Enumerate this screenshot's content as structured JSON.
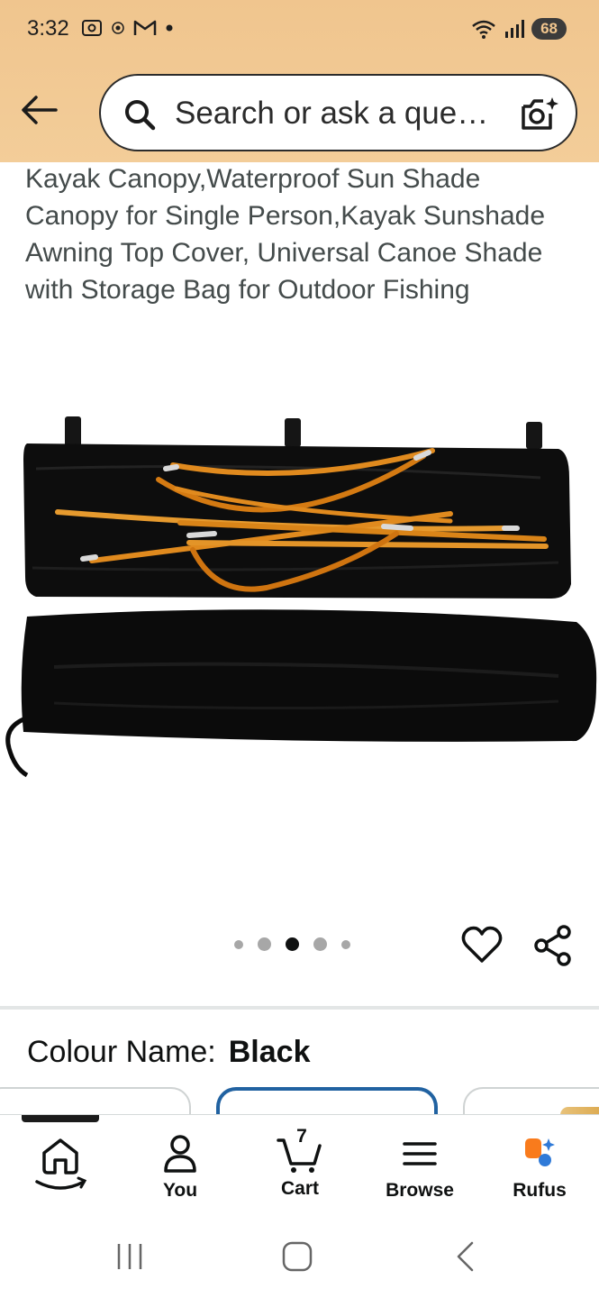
{
  "status_bar": {
    "time": "3:32",
    "left_icons": [
      "screenshot-icon",
      "app-icon",
      "gmail-icon",
      "notification-dot-icon"
    ],
    "right_icons": [
      "wifi-icon",
      "signal-icon"
    ],
    "battery": "68"
  },
  "header": {
    "search_placeholder": "Search or ask a que…",
    "icons": [
      "back-arrow-icon",
      "search-icon",
      "camera-icon"
    ]
  },
  "product": {
    "title": "Kayak Canopy,Waterproof Sun Shade Canopy for Single Person,Kayak Sunshade Awning Top Cover, Universal Canoe Shade with Storage Bag for Outdoor Fishing",
    "image_count": 5,
    "active_image_index": 2
  },
  "variation": {
    "label": "Colour Name:",
    "value": "Black"
  },
  "bottom_nav": {
    "items": [
      {
        "label": "",
        "icon": "home-icon"
      },
      {
        "label": "You",
        "icon": "user-icon"
      },
      {
        "label": "Cart",
        "icon": "cart-icon",
        "count": "7"
      },
      {
        "label": "Browse",
        "icon": "menu-icon"
      },
      {
        "label": "Rufus",
        "icon": "rufus-icon"
      }
    ]
  },
  "colors": {
    "header_bg": "#f0c58e",
    "selected_swatch": "#2162a1",
    "text": "#0f1111",
    "pole_orange": "#e08a1e"
  }
}
